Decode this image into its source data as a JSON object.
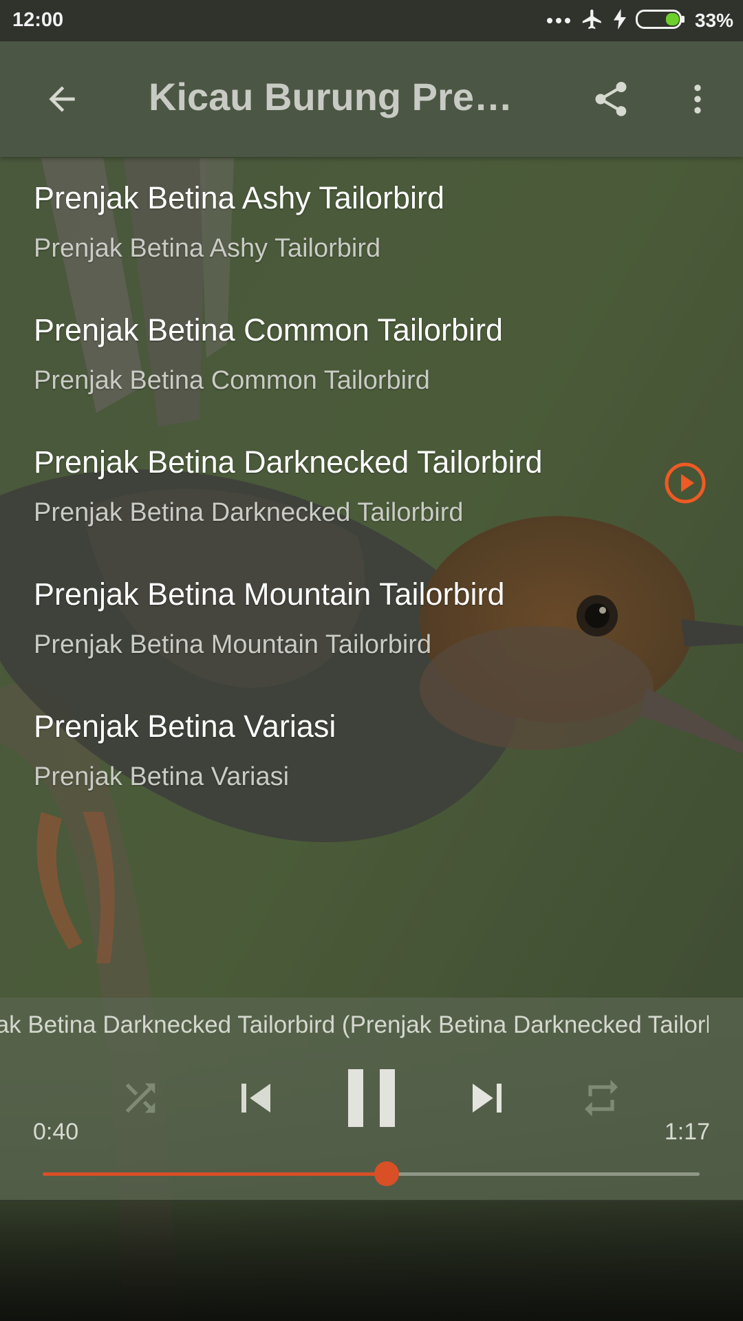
{
  "status_bar": {
    "time": "12:00",
    "battery_percent": "33%",
    "battery_level": 0.33,
    "icons": [
      "more-dots-icon",
      "airplane-mode-icon",
      "charging-bolt-icon",
      "battery-icon"
    ]
  },
  "app_bar": {
    "title": "Kicau Burung Prenjak Betina Terbaik",
    "back_icon": "arrow-left-icon",
    "share_icon": "share-icon",
    "more_icon": "overflow-menu-icon"
  },
  "tracks": [
    {
      "title": "Prenjak Betina Ashy Tailorbird",
      "subtitle": "Prenjak Betina Ashy Tailorbird"
    },
    {
      "title": "Prenjak Betina Common Tailorbird",
      "subtitle": "Prenjak Betina Common Tailorbird"
    },
    {
      "title": "Prenjak Betina Darknecked Tailorbird",
      "subtitle": "Prenjak Betina Darknecked Tailorbird",
      "playing": true
    },
    {
      "title": "Prenjak Betina Mountain Tailorbird",
      "subtitle": "Prenjak Betina Mountain Tailorbird"
    },
    {
      "title": "Prenjak Betina Variasi",
      "subtitle": "Prenjak Betina Variasi"
    }
  ],
  "player": {
    "now_playing": "Prenjak Betina Darknecked Tailorbird (Prenjak Betina Darknecked Tailorbird)",
    "elapsed": "0:40",
    "total": "1:17",
    "progress": 0.524,
    "controls": [
      "shuffle-icon",
      "skip-previous-icon",
      "pause-icon",
      "skip-next-icon",
      "repeat-icon"
    ]
  },
  "colors": {
    "accent": "#d94f26",
    "play_indicator": "#f05a24",
    "app_bar": "#4c5645",
    "status_bar": "#2f332c"
  }
}
